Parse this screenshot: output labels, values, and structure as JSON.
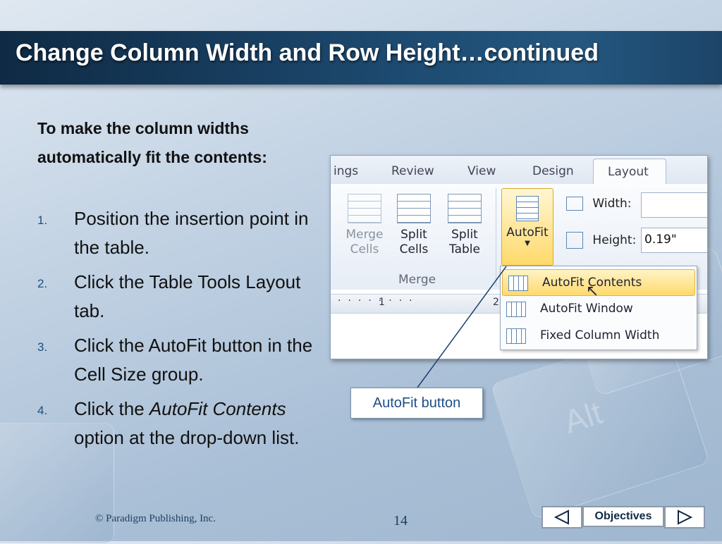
{
  "title": "Change Column Width and Row Height…continued",
  "intro": "To make the column widths automatically fit the contents:",
  "steps": [
    {
      "num": "1.",
      "text": "Position the insertion point in the table."
    },
    {
      "num": "2.",
      "text": "Click the Table Tools Layout tab."
    },
    {
      "num": "3.",
      "text": "Click the AutoFit button in the Cell Size group."
    },
    {
      "num": "4.",
      "prefix": "Click the ",
      "italic": "AutoFit Contents",
      "suffix": " option at the drop-down list."
    }
  ],
  "screenshot": {
    "tabs": [
      "ings",
      "Review",
      "View",
      "Design"
    ],
    "active_tab": "Layout",
    "ribbon_buttons": [
      {
        "line1": "Merge",
        "line2": "Cells"
      },
      {
        "line1": "Split",
        "line2": "Cells"
      },
      {
        "line1": "Split",
        "line2": "Table"
      }
    ],
    "autofit_label": "AutoFit",
    "merge_group": "Merge",
    "width_label": "Width:",
    "width_value": "",
    "height_label": "Height:",
    "height_value": "0.19\"",
    "ruler_1": "1",
    "ruler_2": "2",
    "dropdown": [
      "AutoFit Contents",
      "AutoFit Window",
      "Fixed Column Width"
    ]
  },
  "callout": "AutoFit button",
  "footer": {
    "copyright": "© Paradigm Publishing, Inc.",
    "page": "14",
    "objectives": "Objectives"
  },
  "colors": {
    "title_bg": "#1d4a70",
    "highlight": "#ffd96b",
    "step_num": "#1e4f7d"
  }
}
